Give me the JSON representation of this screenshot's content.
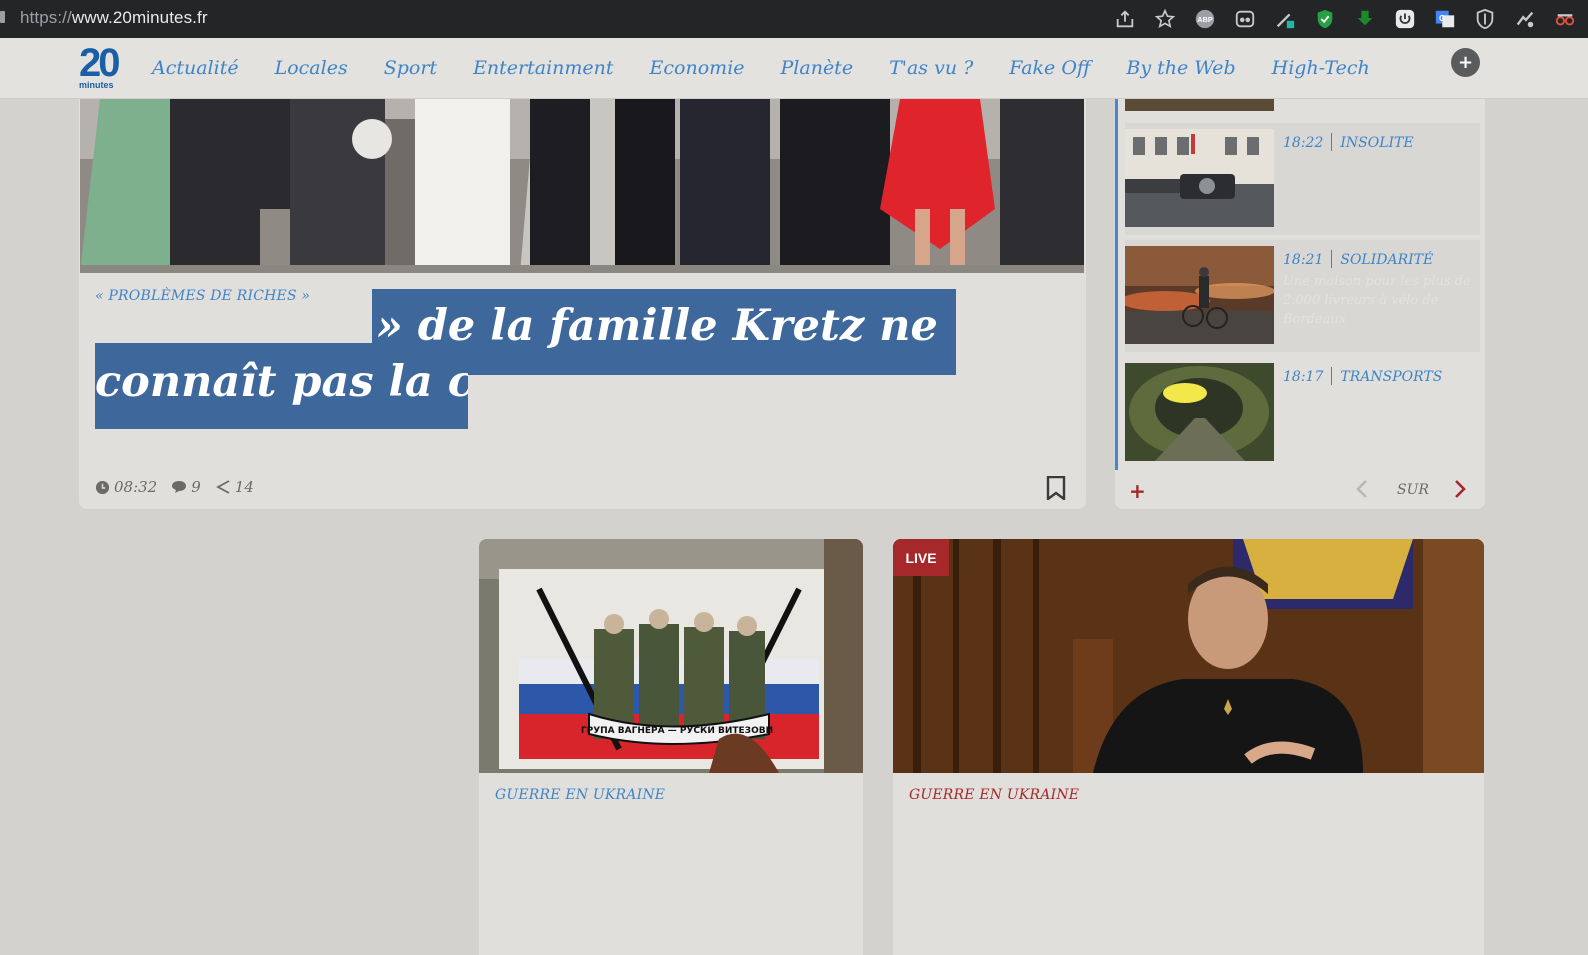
{
  "browser": {
    "url_scheme": "https://",
    "url_host": "www.20minutes.fr",
    "extensions": [
      "share-icon",
      "star-icon",
      "adblock-icon",
      "reader-icon",
      "pen-icon",
      "shield-check-icon",
      "download-icon",
      "power-icon",
      "translate-icon",
      "ublock-icon",
      "puzzle-icon",
      "spy-icon"
    ]
  },
  "site": {
    "logo_number": "20",
    "logo_word": "minutes",
    "nav": [
      "Actualité",
      "Locales",
      "Sport",
      "Entertainment",
      "Economie",
      "Planète",
      "T'as vu ?",
      "Fake Off",
      "By the Web",
      "High-Tech"
    ],
    "plus_label": "+"
  },
  "hero": {
    "rubric": "« PROBLÈMES DE RICHES »",
    "headline_line1": "» de la famille Kretz ne",
    "headline_line2": "connaît pas la c",
    "time": "08:32",
    "comments": "9",
    "shares": "14"
  },
  "feed": {
    "items": [
      {
        "time": "18:22",
        "category": "INSOLITE",
        "summary": ""
      },
      {
        "time": "18:21",
        "category": "SOLIDARITÉ",
        "summary": "Une maison pour les plus de 2.000 livreurs à vélo de Bordeaux"
      },
      {
        "time": "18:17",
        "category": "TRANSPORTS",
        "summary": ""
      }
    ],
    "plus_label": "+",
    "pager_label": "SUR"
  },
  "cards": [
    {
      "rubric": "GUERRE EN UKRAINE",
      "rubric_color": "#3f84c8",
      "mural_text": "ГРУПА ВАГНЕРА — РУСКИ ВИТЕЗОВИ"
    },
    {
      "rubric": "GUERRE EN UKRAINE",
      "rubric_color": "#a6282b",
      "badge": "LIVE"
    }
  ],
  "colors": {
    "accent_blue": "#3f84c8",
    "accent_red": "#a6282b",
    "highlight": "#3e689c"
  }
}
